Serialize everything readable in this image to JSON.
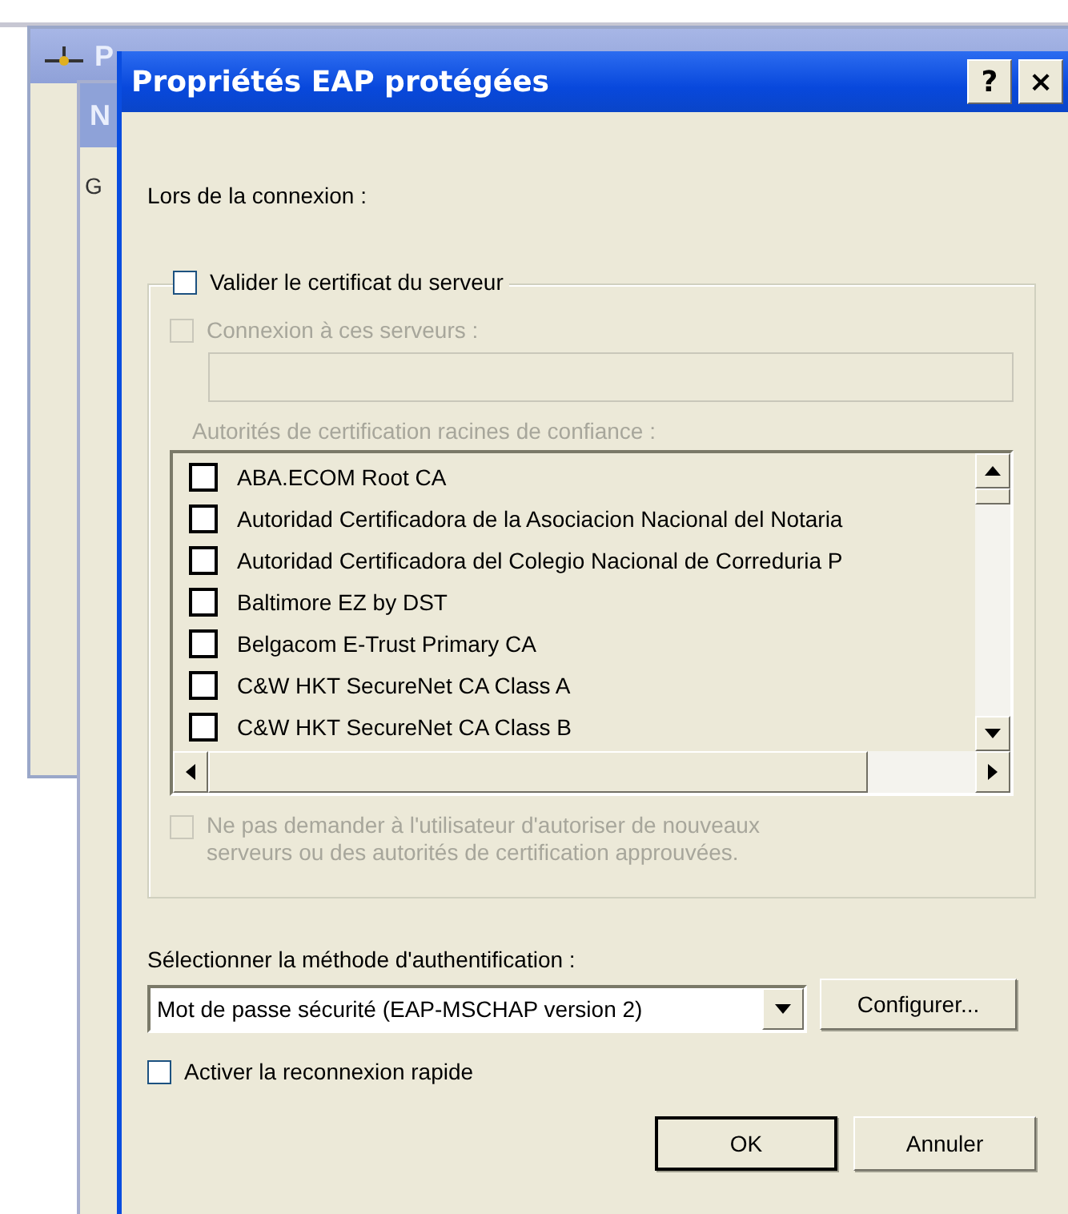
{
  "background_windows": [
    {
      "title": "P"
    },
    {
      "title": "N",
      "tab": "G"
    }
  ],
  "dialog": {
    "title": "Propriétés EAP protégées",
    "help_button": "?",
    "close_button": "×"
  },
  "connection_label": "Lors de la connexion :",
  "validate_certificate": {
    "label": "Valider le certificat du serveur",
    "checked": false
  },
  "connect_to_servers": {
    "label": "Connexion à ces serveurs :",
    "checked": false,
    "disabled": true
  },
  "ca_label": "Autorités de certification racines de confiance :",
  "ca_list": [
    {
      "label": "ABA.ECOM Root CA",
      "checked": false
    },
    {
      "label": "Autoridad Certificadora de la Asociacion Nacional del Notaria",
      "checked": false
    },
    {
      "label": "Autoridad Certificadora del Colegio Nacional de Correduria P",
      "checked": false
    },
    {
      "label": "Baltimore EZ by DST",
      "checked": false
    },
    {
      "label": "Belgacom E-Trust Primary CA",
      "checked": false
    },
    {
      "label": "C&W HKT SecureNet CA Class A",
      "checked": false
    },
    {
      "label": "C&W HKT SecureNet CA Class B",
      "checked": false
    }
  ],
  "no_prompt": {
    "label": "Ne pas demander à l'utilisateur d'autoriser de nouveaux serveurs ou des autorités de certification approuvées.",
    "checked": false,
    "disabled": true
  },
  "auth_label": "Sélectionner la méthode d'authentification :",
  "auth_method": {
    "value": "Mot de passe sécurité (EAP-MSCHAP version 2)"
  },
  "configure_button": "Configurer...",
  "fast_reconnect": {
    "label": "Activer la reconnexion rapide",
    "checked": false
  },
  "buttons": [
    "OK",
    "Annuler"
  ]
}
